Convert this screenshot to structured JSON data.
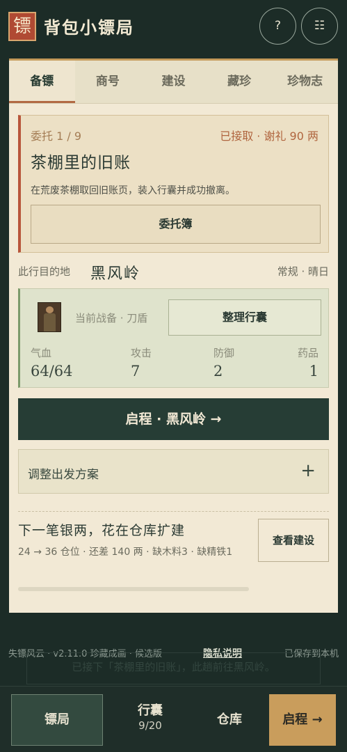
{
  "header": {
    "logo_char": "镖",
    "title": "背包小镖局",
    "help_label": "?",
    "menu_label": "☷"
  },
  "tabs": [
    {
      "label": "备镖",
      "active": true
    },
    {
      "label": "商号",
      "active": false
    },
    {
      "label": "建设",
      "active": false
    },
    {
      "label": "藏珍",
      "active": false
    },
    {
      "label": "珍物志",
      "active": false
    }
  ],
  "commission": {
    "count": "委托 1 / 9",
    "status": "已接取 · 谢礼 90 两",
    "title": "茶棚里的旧账",
    "description": "在荒废茶棚取回旧账页，装入行囊并成功撤离。",
    "button_label": "委托簿"
  },
  "destination": {
    "label": "此行目的地",
    "name": "黑风岭",
    "conditions": "常规 · 晴日"
  },
  "status": {
    "gear": "当前战备 · 刀盾",
    "pack_button": "整理行囊",
    "stats": [
      {
        "label": "气血",
        "value": "64/64"
      },
      {
        "label": "攻击",
        "value": "7"
      },
      {
        "label": "防御",
        "value": "2"
      },
      {
        "label": "药品",
        "value": "1"
      }
    ]
  },
  "start_button": "启程 · 黑风岭 →",
  "plan": {
    "label": "调整出发方案",
    "toggle": "+"
  },
  "next_goal": {
    "title": "下一笔银两，花在仓库扩建",
    "detail": "24 → 36 仓位 · 还差 140 两 · 缺木料3 · 缺精铁1",
    "button_label": "查看建设",
    "progress": 0.0
  },
  "footer": {
    "version": "失镖风云 · v2.11.0 珍藏成画 · 候选版",
    "privacy": "隐私说明",
    "saved": "已保存到本机"
  },
  "toast": "已接下「茶棚里的旧账」，此趟前往黑风岭。",
  "bottom_nav": {
    "home": "镖局",
    "bag": "行囊",
    "bag_count": "9/20",
    "store": "仓库",
    "go": "启程 →"
  },
  "colors": {
    "background": "#1c2c27",
    "card": "#f2e9d5",
    "accent_red": "#b8553a",
    "accent_green": "#7c9a6b",
    "primary_button": "#263d35",
    "go_button": "#c99d5c"
  }
}
